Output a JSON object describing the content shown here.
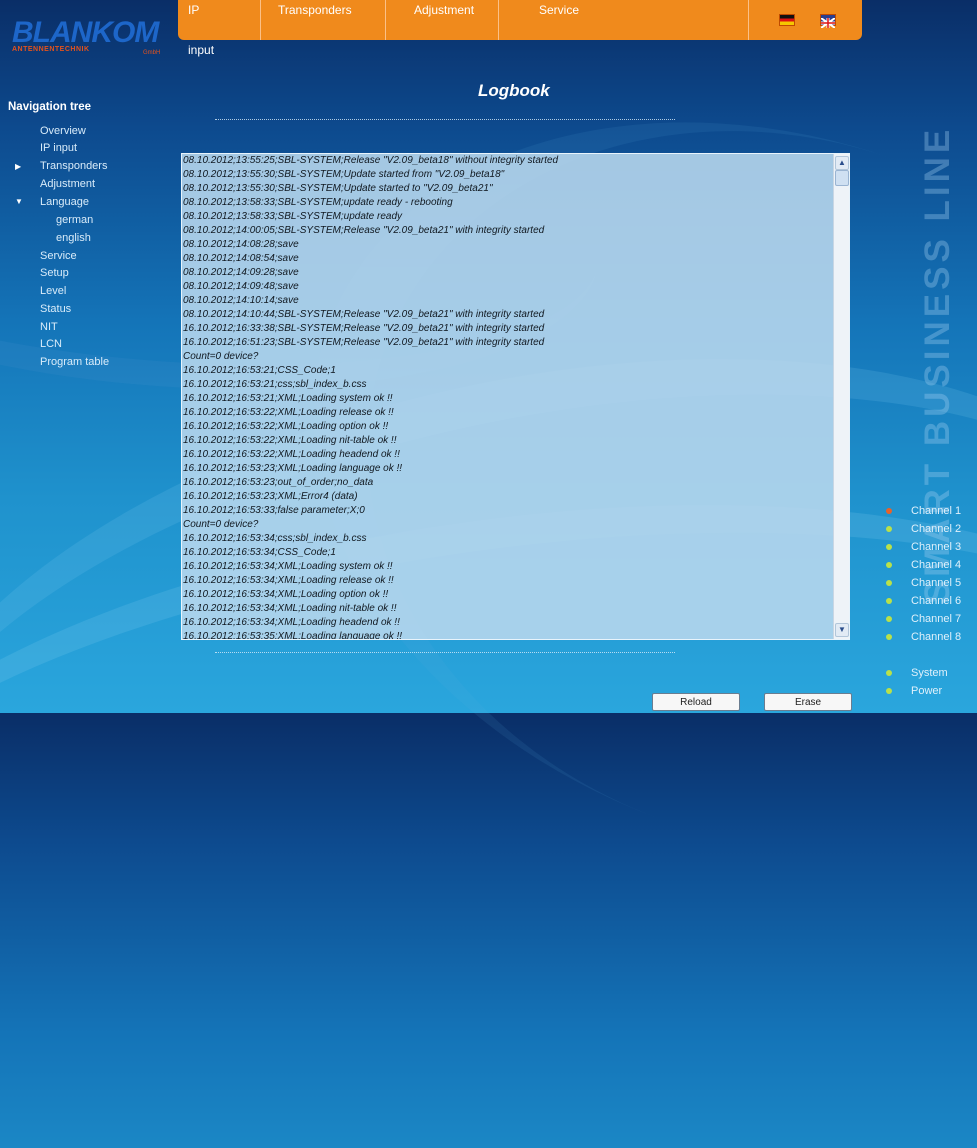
{
  "logo": {
    "name": "BLANKOM",
    "tagline": "ANTENNENTECHNIK",
    "suffix": "GmbH"
  },
  "topnav": {
    "tabs": [
      "IP input",
      "Transponders",
      "Adjustment",
      "Service"
    ]
  },
  "nav": {
    "title": "Navigation tree",
    "items": [
      "Overview",
      "IP input",
      "Transponders",
      "Adjustment",
      "Language",
      "german",
      "english",
      "Service",
      "Setup",
      "Level",
      "Status",
      "NIT",
      "LCN",
      "Program table"
    ]
  },
  "page_title": "Logbook",
  "log": [
    "08.10.2012;13:55:25;SBL-SYSTEM;Release \"V2.09_beta18\" without integrity started",
    "08.10.2012;13:55:30;SBL-SYSTEM;Update started from \"V2.09_beta18\"",
    "08.10.2012;13:55:30;SBL-SYSTEM;Update started to \"V2.09_beta21\"",
    "08.10.2012;13:58:33;SBL-SYSTEM;update ready - rebooting",
    "08.10.2012;13:58:33;SBL-SYSTEM;update ready",
    "08.10.2012;14:00:05;SBL-SYSTEM;Release \"V2.09_beta21\" with integrity started",
    "08.10.2012;14:08:28;save",
    "08.10.2012;14:08:54;save",
    "08.10.2012;14:09:28;save",
    "08.10.2012;14:09:48;save",
    "08.10.2012;14:10:14;save",
    "08.10.2012;14:10:44;SBL-SYSTEM;Release \"V2.09_beta21\" with integrity started",
    "16.10.2012;16:33:38;SBL-SYSTEM;Release \"V2.09_beta21\" with integrity started",
    "16.10.2012;16:51:23;SBL-SYSTEM;Release \"V2.09_beta21\" with integrity started",
    "Count=0 device?",
    "16.10.2012;16:53:21;CSS_Code;1",
    "16.10.2012;16:53:21;css;sbl_index_b.css",
    "16.10.2012;16:53:21;XML;Loading system ok !!",
    "16.10.2012;16:53:22;XML;Loading release ok !!",
    "16.10.2012;16:53:22;XML;Loading option ok !!",
    "16.10.2012;16:53:22;XML;Loading nit-table ok !!",
    "16.10.2012;16:53:22;XML;Loading headend ok !!",
    "16.10.2012;16:53:23;XML;Loading language ok !!",
    "16.10.2012;16:53:23;out_of_order;no_data",
    "16.10.2012;16:53:23;XML;Error4 (data)",
    "16.10.2012;16:53:33;false parameter;X;0",
    "Count=0 device?",
    "16.10.2012;16:53:34;css;sbl_index_b.css",
    "16.10.2012;16:53:34;CSS_Code;1",
    "16.10.2012;16:53:34;XML;Loading system ok !!",
    "16.10.2012;16:53:34;XML;Loading release ok !!",
    "16.10.2012;16:53:34;XML;Loading option ok !!",
    "16.10.2012;16:53:34;XML;Loading nit-table ok !!",
    "16.10.2012;16:53:34;XML;Loading headend ok !!",
    "16.10.2012;16:53:35;XML;Loading language ok !!"
  ],
  "side_text": "SMART BUSINESS LINE",
  "channels": [
    "Channel 1",
    "Channel 2",
    "Channel 3",
    "Channel 4",
    "Channel 5",
    "Channel 6",
    "Channel 7",
    "Channel 8"
  ],
  "status": [
    "System",
    "Power"
  ],
  "buttons": {
    "reload": "Reload",
    "erase": "Erase"
  },
  "colors": {
    "accent": "#f08a1c",
    "active_led": "#e8622a",
    "ok_led": "#b9e14a"
  }
}
